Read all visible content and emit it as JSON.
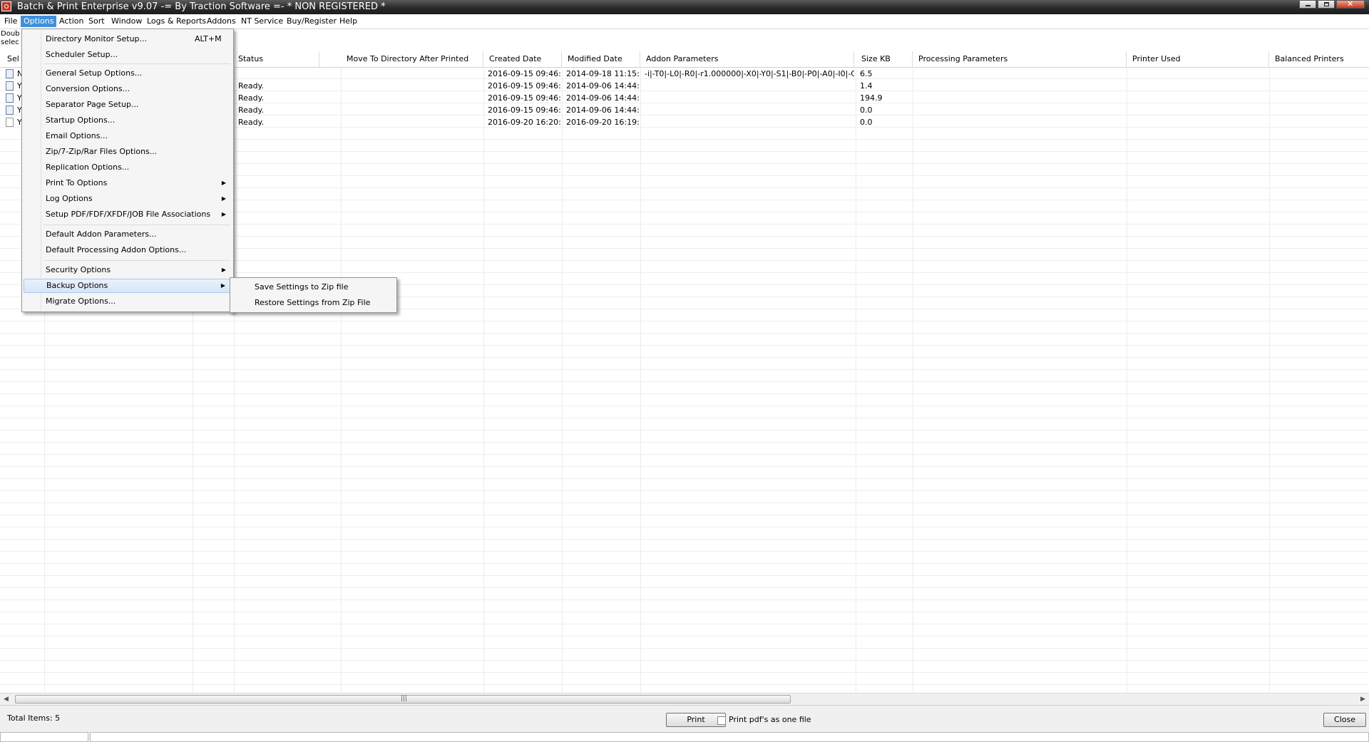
{
  "window": {
    "title": "Batch & Print Enterprise v9.07 -= By Traction Software =- * NON REGISTERED *",
    "icon": "app-logo-icon"
  },
  "menubar": {
    "items": [
      "File",
      "Options",
      "Action",
      "Sort",
      "Window",
      "Logs & Reports",
      "Addons",
      "NT Service",
      "Buy/Register",
      "Help"
    ],
    "active": "Options"
  },
  "left_hint": [
    "Doubl",
    "select"
  ],
  "table": {
    "first_header_clipped": "Sel",
    "headers": [
      "Status",
      "Move To Directory After Printed",
      "Created Date",
      "Modified Date",
      "Addon Parameters",
      "Size KB",
      "Processing Parameters",
      "Printer Used",
      "Balanced Printers"
    ],
    "rows": [
      {
        "lead": "N",
        "status": "",
        "move_to": "",
        "created": "2016-09-15 09:46:...",
        "modified": "2014-09-18 11:15:...",
        "addon": "-i|-T0|-L0|-R0|-r1.000000|-X0|-Y0|-S1|-B0|-P0|-A0|-I0|-C1|-s0|-e...",
        "size": "6.5",
        "processing": "",
        "printer": "",
        "balanced": ""
      },
      {
        "lead": "Y",
        "status": "Ready.",
        "move_to": "",
        "created": "2016-09-15 09:46:...",
        "modified": "2014-09-06 14:44:...",
        "addon": "",
        "size": "1.4",
        "processing": "",
        "printer": "",
        "balanced": ""
      },
      {
        "lead": "Y",
        "status": "Ready.",
        "move_to": "",
        "created": "2016-09-15 09:46:...",
        "modified": "2014-09-06 14:44:...",
        "addon": "",
        "size": "194.9",
        "processing": "",
        "printer": "",
        "balanced": ""
      },
      {
        "lead": "Y",
        "status": "Ready.",
        "move_to": "",
        "created": "2016-09-15 09:46:...",
        "modified": "2014-09-06 14:44:...",
        "addon": "",
        "size": "0.0",
        "processing": "",
        "printer": "",
        "balanced": ""
      },
      {
        "lead": "Y",
        "status": "Ready.",
        "move_to": "",
        "created": "2016-09-20 16:20:...",
        "modified": "2016-09-20 16:19:...",
        "addon": "",
        "size": "0.0",
        "processing": "",
        "printer": "",
        "balanced": ""
      }
    ]
  },
  "options_menu": {
    "items": [
      {
        "label": "Directory Monitor Setup...",
        "shortcut": "ALT+M"
      },
      {
        "label": "Scheduler Setup..."
      },
      {
        "label": "General Setup Options..."
      },
      {
        "label": "Conversion Options..."
      },
      {
        "label": "Separator Page Setup..."
      },
      {
        "label": "Startup Options..."
      },
      {
        "label": "Email Options..."
      },
      {
        "label": "Zip/7-Zip/Rar Files Options..."
      },
      {
        "label": "Replication Options..."
      },
      {
        "label": "Print To Options",
        "submenu": true
      },
      {
        "label": "Log Options",
        "submenu": true
      },
      {
        "label": "Setup PDF/FDF/XFDF/JOB File Associations",
        "submenu": true
      },
      {
        "label": "Default Addon Parameters..."
      },
      {
        "label": "Default Processing Addon Options..."
      },
      {
        "label": "Security Options",
        "submenu": true
      },
      {
        "label": "Backup Options",
        "submenu": true,
        "highlighted": true
      },
      {
        "label": "Migrate Options..."
      }
    ]
  },
  "backup_submenu": {
    "items": [
      "Save Settings to Zip file",
      "Restore Settings from Zip File"
    ]
  },
  "statusbar": {
    "total_label": "Total Items:",
    "total_value": "5",
    "print_button": "Print",
    "one_file_checkbox": "Print pdf's as one file",
    "one_file_checked": false,
    "close_button": "Close"
  },
  "colors": {
    "menu_active": "#3f8fd9",
    "titlebar": "#2a2a2a",
    "menu_hover_border": "#a8c8ec"
  }
}
